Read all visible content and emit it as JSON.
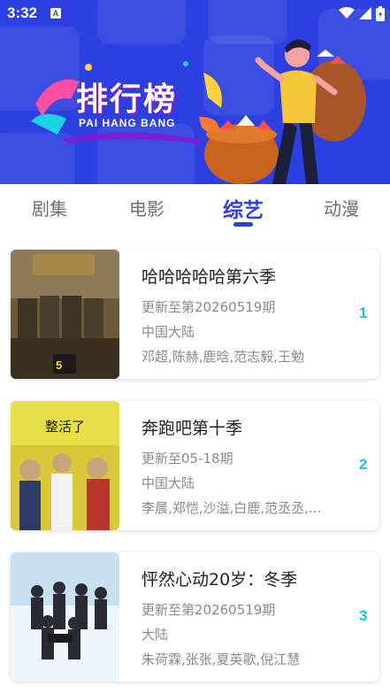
{
  "status_bar": {
    "time": "3:32",
    "notification_icon": "A"
  },
  "banner": {
    "title": "排行榜",
    "subtitle": "PAI HANG BANG"
  },
  "tabs": [
    {
      "label": "剧集",
      "active": false
    },
    {
      "label": "电影",
      "active": false
    },
    {
      "label": "综艺",
      "active": true
    },
    {
      "label": "动漫",
      "active": false
    }
  ],
  "colors": {
    "accent": "#2c3fe0",
    "rank": "#19c6c6"
  },
  "shows": [
    {
      "title": "哈哈哈哈哈第六季",
      "update": "更新至第20260519期",
      "region": "中国大陆",
      "cast": "邓超,陈赫,鹿晗,范志毅,王勉",
      "rank": "1"
    },
    {
      "title": "奔跑吧第十季",
      "update": "更新至05-18期",
      "region": "中国大陆",
      "cast": "李晨,郑恺,沙溢,白鹿,范丞丞,...",
      "rank": "2",
      "poster_text": "整活了"
    },
    {
      "title": "怦然心动20岁：冬季",
      "update": "更新至第20260519期",
      "region": "大陆",
      "cast": "朱荷霖,张张,夏英歌,倪江慧",
      "rank": "3"
    }
  ]
}
